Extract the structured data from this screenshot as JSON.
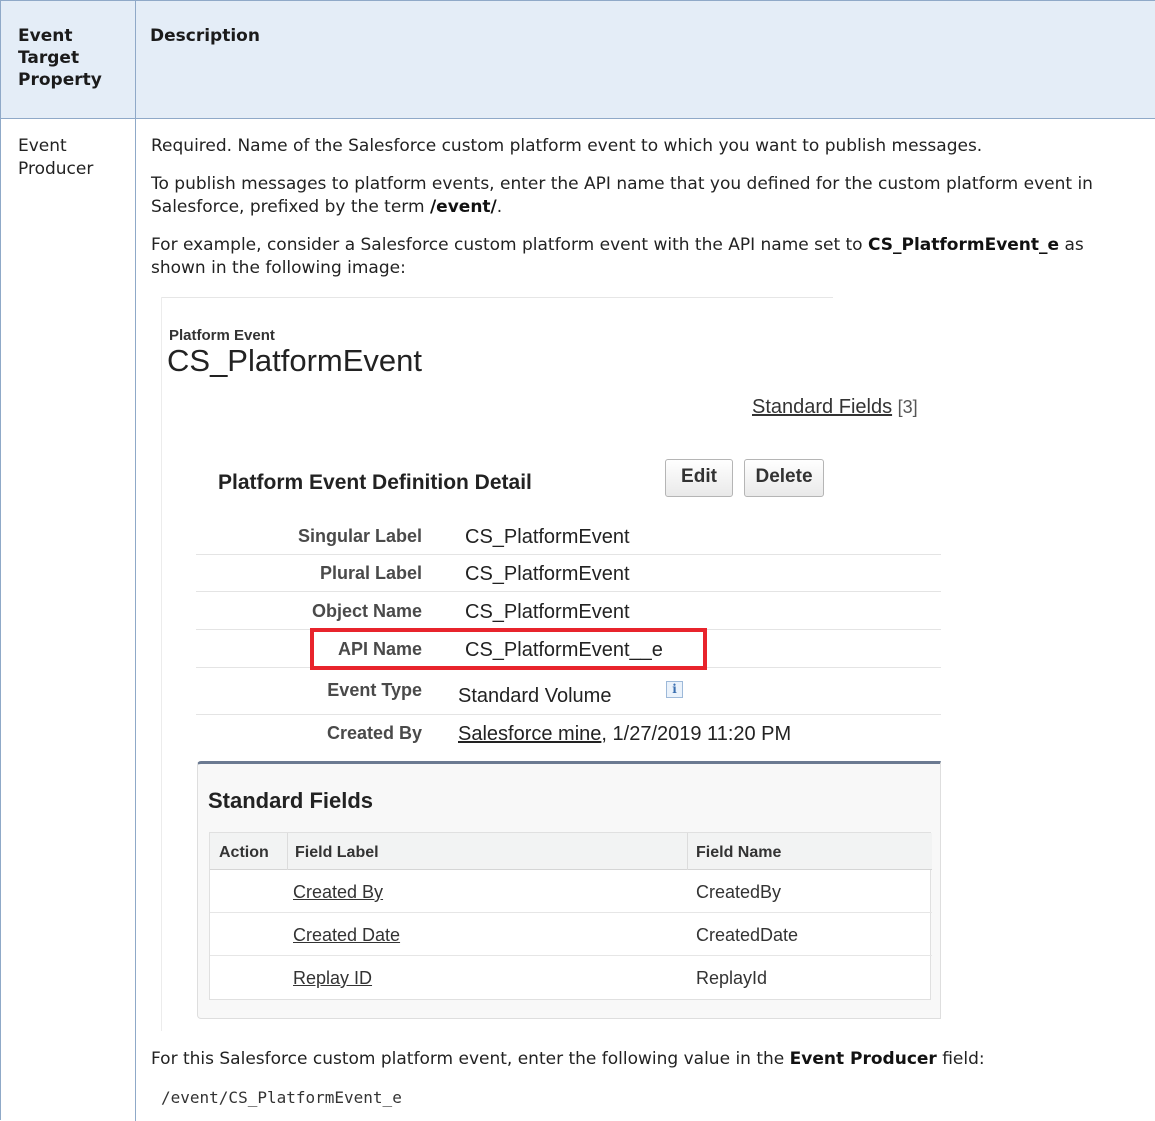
{
  "header": {
    "col1": "Event Target Property",
    "col2": "Description"
  },
  "row": {
    "property": "Event Producer",
    "p1": "Required. Name of the Salesforce custom platform event to which you want to publish messages.",
    "p2_pre": "To publish messages to platform events, enter the API name that you defined for the custom platform event in Salesforce, prefixed by the term ",
    "p2_bold": "/event/",
    "p2_post": ".",
    "p3_pre": "For example, consider a Salesforce custom platform event with the API name set to ",
    "p3_bold": "CS_PlatformEvent_e",
    "p3_post": " as shown in the following image:",
    "p4_pre": "For this Salesforce custom platform event, enter the following value in the ",
    "p4_bold": "Event Producer",
    "p4_post": " field:",
    "code": "/event/CS_PlatformEvent_e"
  },
  "screenshot": {
    "object_label": "Platform Event",
    "object_title": "CS_PlatformEvent",
    "standard_fields_link": "Standard Fields",
    "standard_fields_count": "[3]",
    "detail_title": "Platform Event Definition Detail",
    "edit_button": "Edit",
    "delete_button": "Delete",
    "details": [
      {
        "label": "Singular Label",
        "value": "CS_PlatformEvent"
      },
      {
        "label": "Plural Label",
        "value": "CS_PlatformEvent"
      },
      {
        "label": "Object Name",
        "value": "CS_PlatformEvent"
      },
      {
        "label": "API Name",
        "value": "CS_PlatformEvent__e"
      },
      {
        "label": "Event Type",
        "value": "Standard Volume"
      },
      {
        "label": "Created By",
        "value_link": "Salesforce mine",
        "value_rest": ", 1/27/2019 11:20 PM"
      }
    ],
    "info_icon": "info-icon",
    "highlight_color": "#e8242c",
    "standard_fields": {
      "title": "Standard Fields",
      "columns": [
        "Action",
        "Field Label",
        "Field Name"
      ],
      "rows": [
        {
          "label": "Created By",
          "name": "CreatedBy"
        },
        {
          "label": "Created Date",
          "name": "CreatedDate"
        },
        {
          "label": "Replay ID",
          "name": "ReplayId"
        }
      ]
    }
  }
}
